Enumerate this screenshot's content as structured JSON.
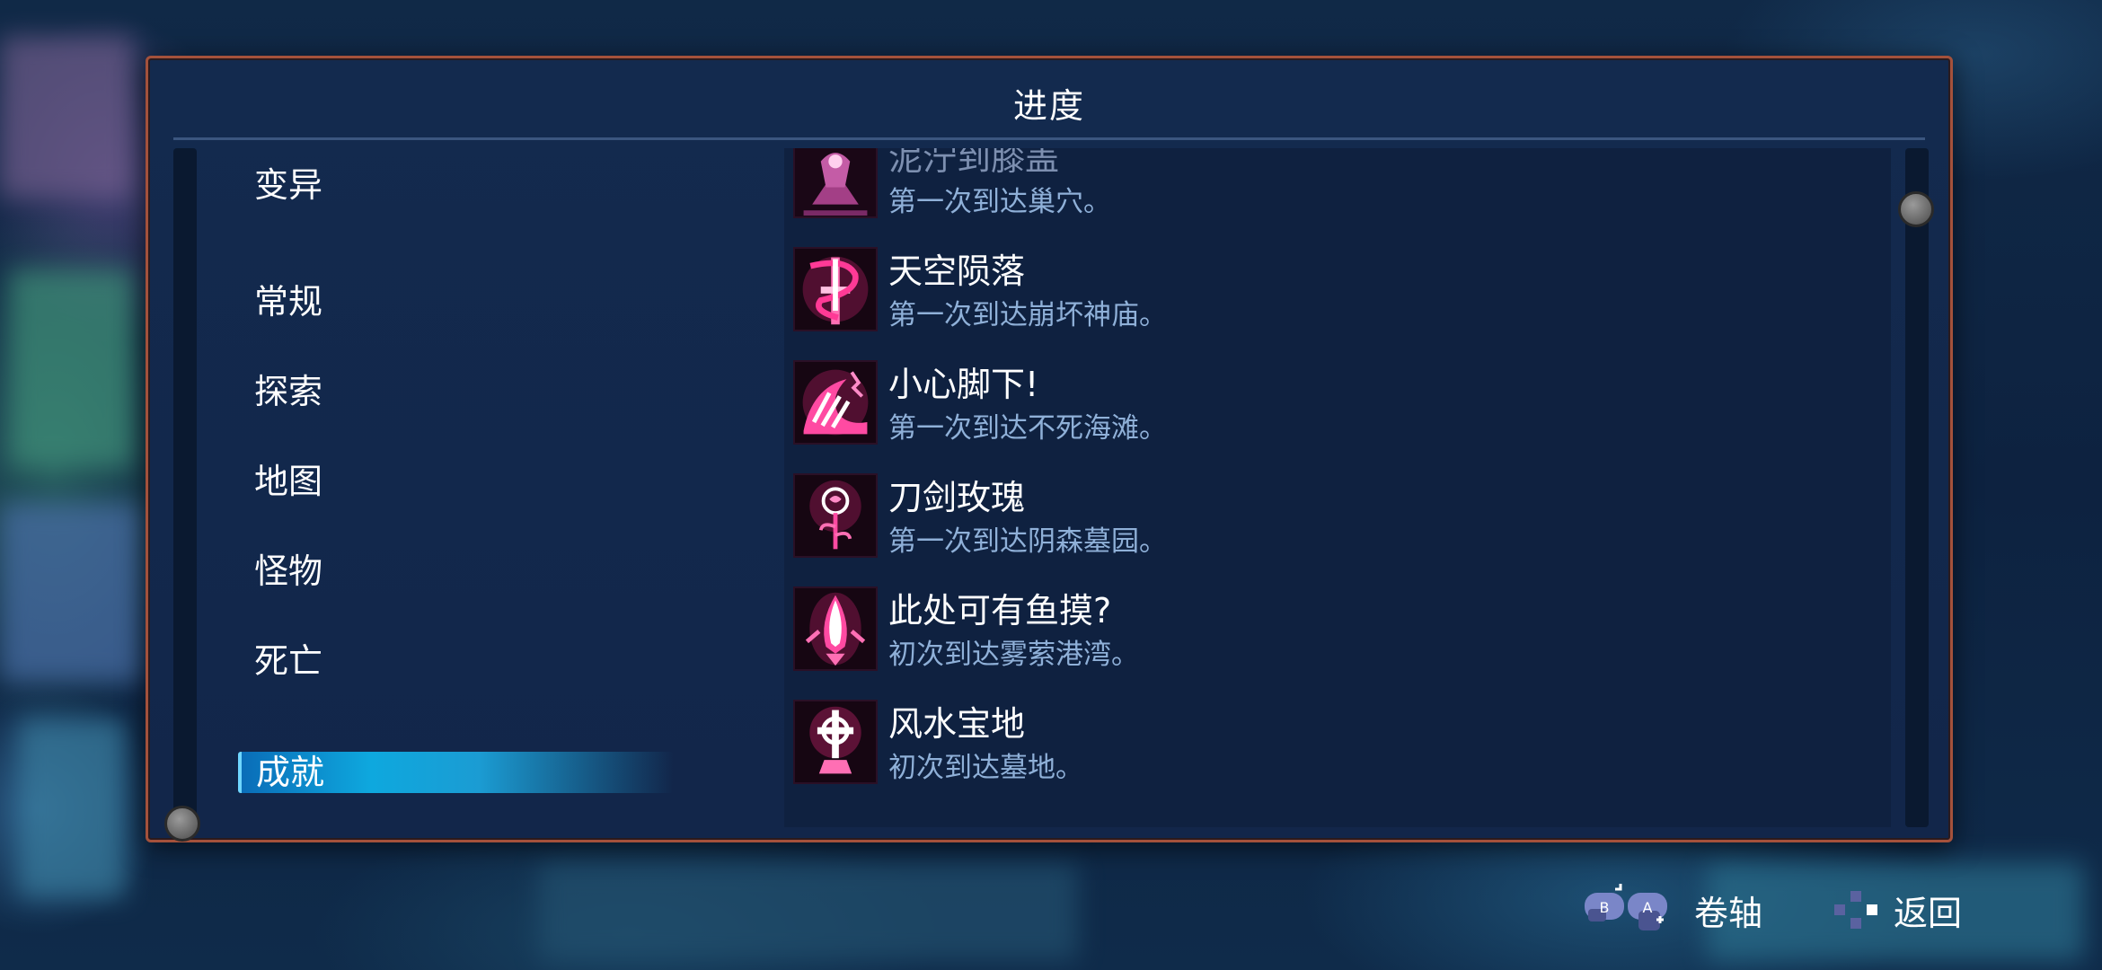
{
  "panel": {
    "title": "进度"
  },
  "categories": [
    {
      "label": "变异"
    },
    {
      "label": "常规"
    },
    {
      "label": "探索"
    },
    {
      "label": "地图"
    },
    {
      "label": "怪物"
    },
    {
      "label": "死亡"
    }
  ],
  "selected_category": {
    "label": "成就"
  },
  "achievements": [
    {
      "title": "泥泞到膝盖",
      "desc": "第一次到达巢穴。",
      "icon": "spider-nest-icon"
    },
    {
      "title": "天空陨落",
      "desc": "第一次到达崩坏神庙。",
      "icon": "serpent-sword-icon"
    },
    {
      "title": "小心脚下!",
      "desc": "第一次到达不死海滩。",
      "icon": "crashing-wave-icon"
    },
    {
      "title": "刀剑玫瑰",
      "desc": "第一次到达阴森墓园。",
      "icon": "rose-icon"
    },
    {
      "title": "此处可有鱼摸?",
      "desc": "初次到达雾萦港湾。",
      "icon": "fish-icon"
    },
    {
      "title": "风水宝地",
      "desc": "初次到达墓地。",
      "icon": "celtic-cross-icon"
    }
  ],
  "controls": {
    "scroll_label": "卷轴",
    "back_label": "返回"
  },
  "colors": {
    "accent_selected": "#0ea8de",
    "panel_border": "#a4513b",
    "icon_glow": "#ff2d8a",
    "desc_text": "#8fb0d8"
  }
}
